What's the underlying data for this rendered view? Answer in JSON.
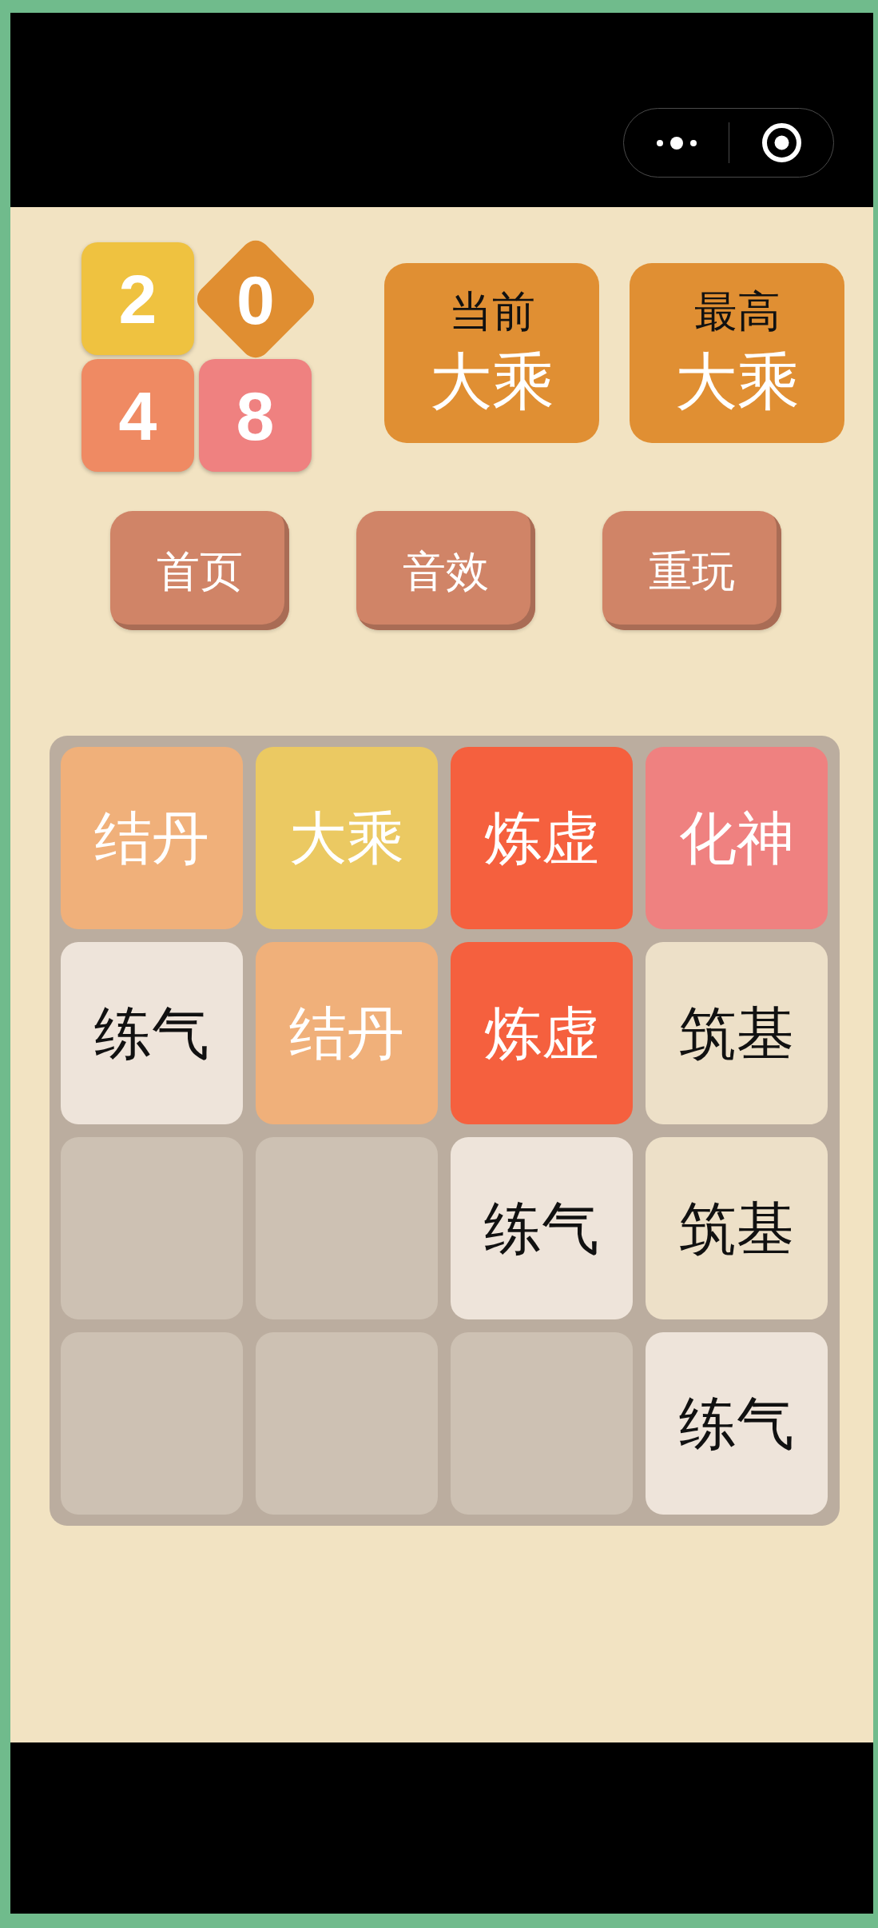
{
  "logo": {
    "tiles": [
      {
        "text": "2",
        "kind": "square",
        "color": "#efc240"
      },
      {
        "text": "0",
        "kind": "diamond",
        "color": "#e08e31"
      },
      {
        "text": "4",
        "kind": "square",
        "color": "#ef8a63"
      },
      {
        "text": "8",
        "kind": "square",
        "color": "#ef8180"
      }
    ]
  },
  "scores": [
    {
      "label": "当前",
      "value": "大乘"
    },
    {
      "label": "最高",
      "value": "大乘"
    }
  ],
  "buttons": [
    "首页",
    "音效",
    "重玩"
  ],
  "board": {
    "rows": [
      [
        {
          "kind": "tile",
          "text": "结丹",
          "color": "#f0b07a"
        },
        {
          "kind": "tile",
          "text": "大乘",
          "color": "#ebc962"
        },
        {
          "kind": "tile",
          "text": "炼虚",
          "color": "#f5603e"
        },
        {
          "kind": "tile",
          "text": "化神",
          "color": "#ef8180"
        }
      ],
      [
        {
          "kind": "tile",
          "text": "练气",
          "color": "#eee4da"
        },
        {
          "kind": "tile",
          "text": "结丹",
          "color": "#f0b07a"
        },
        {
          "kind": "tile",
          "text": "炼虚",
          "color": "#f5603e"
        },
        {
          "kind": "tile",
          "text": "筑基",
          "color": "#ede0c8"
        }
      ],
      [
        {
          "kind": "empty"
        },
        {
          "kind": "empty"
        },
        {
          "kind": "tile",
          "text": "练气",
          "color": "#eee4da"
        },
        {
          "kind": "tile",
          "text": "筑基",
          "color": "#ede0c8"
        }
      ],
      [
        {
          "kind": "empty"
        },
        {
          "kind": "empty"
        },
        {
          "kind": "empty"
        },
        {
          "kind": "tile",
          "text": "练气",
          "color": "#eee4da"
        }
      ]
    ]
  }
}
